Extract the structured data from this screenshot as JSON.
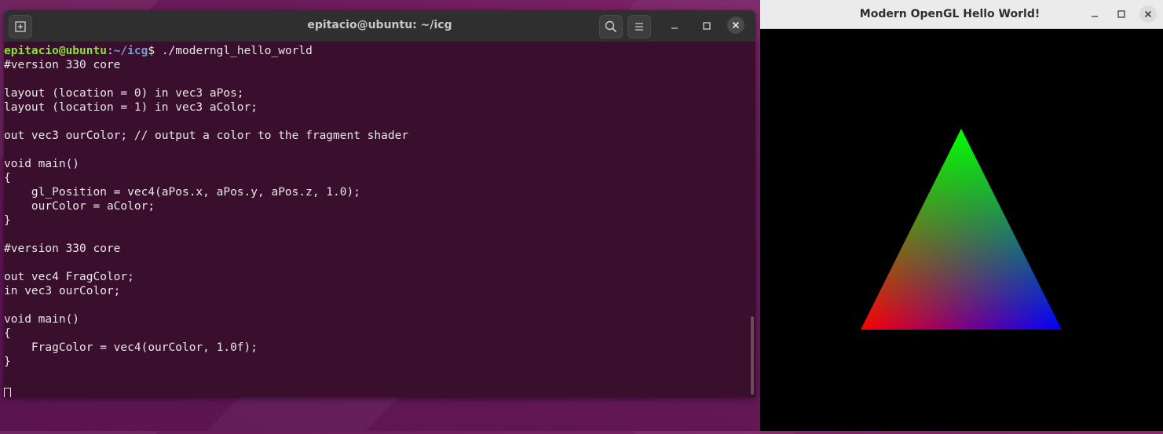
{
  "terminal": {
    "title": "epitacio@ubuntu: ~/icg",
    "prompt_user": "epitacio@ubuntu",
    "prompt_sep": ":",
    "prompt_path": "~/icg",
    "prompt_end": "$ ",
    "command": "./moderngl_hello_world",
    "output": [
      "#version 330 core",
      "",
      "layout (location = 0) in vec3 aPos;",
      "layout (location = 1) in vec3 aColor;",
      "",
      "out vec3 ourColor; // output a color to the fragment shader",
      "",
      "void main()",
      "{",
      "    gl_Position = vec4(aPos.x, aPos.y, aPos.z, 1.0);",
      "    ourColor = aColor;",
      "}",
      "",
      "#version 330 core",
      "",
      "out vec4 FragColor;",
      "in vec3 ourColor;",
      "",
      "void main()",
      "{",
      "    FragColor = vec4(ourColor, 1.0f);",
      "}",
      ""
    ],
    "icons": {
      "new_tab": "new-tab-icon",
      "search": "search-icon",
      "menu": "hamburger-menu-icon",
      "minimize": "minimize-icon",
      "maximize": "maximize-icon",
      "close": "close-icon"
    }
  },
  "gl_window": {
    "title": "Modern OpenGL Hello World!",
    "triangle_colors": {
      "top": "#00ff00",
      "left": "#ff0000",
      "right": "#0000ff"
    }
  }
}
